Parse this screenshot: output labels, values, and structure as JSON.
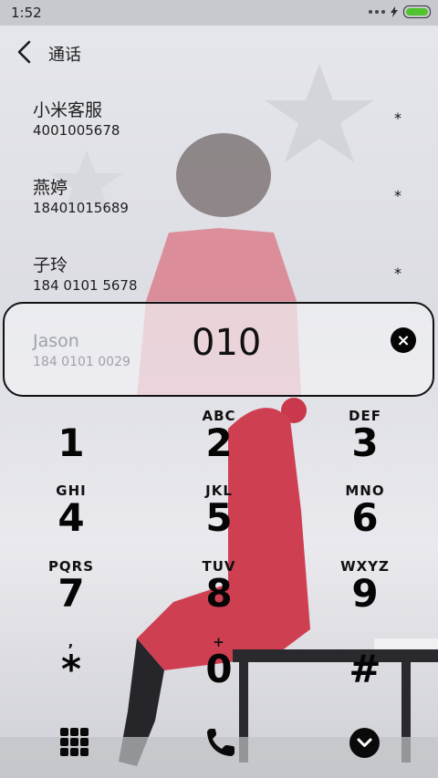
{
  "status_bar": {
    "time": "1:52"
  },
  "header": {
    "title": "通话"
  },
  "contacts": [
    {
      "name": "小米客服",
      "number": "4001005678",
      "star": "*"
    },
    {
      "name": "燕婷",
      "number": "18401015689",
      "star": "*"
    },
    {
      "name": "子玲",
      "number": "184 0101 5678",
      "star": "*"
    }
  ],
  "search": {
    "suggest_name": "Jason",
    "suggest_number": "184 0101 0029",
    "input": "010",
    "clear": "×"
  },
  "dialpad": [
    {
      "digit": "1",
      "letters": ""
    },
    {
      "digit": "2",
      "letters": "ABC"
    },
    {
      "digit": "3",
      "letters": "DEF"
    },
    {
      "digit": "4",
      "letters": "GHI"
    },
    {
      "digit": "5",
      "letters": "JKL"
    },
    {
      "digit": "6",
      "letters": "MNO"
    },
    {
      "digit": "7",
      "letters": "PQRS"
    },
    {
      "digit": "8",
      "letters": "TUV"
    },
    {
      "digit": "9",
      "letters": "WXYZ"
    },
    {
      "digit": "*",
      "letters": ","
    },
    {
      "digit": "0",
      "letters": "+"
    },
    {
      "digit": "#",
      "letters": ""
    }
  ],
  "bottom_bar": {
    "icons": [
      "grid-icon",
      "phone-icon",
      "chevron-down-icon"
    ]
  }
}
